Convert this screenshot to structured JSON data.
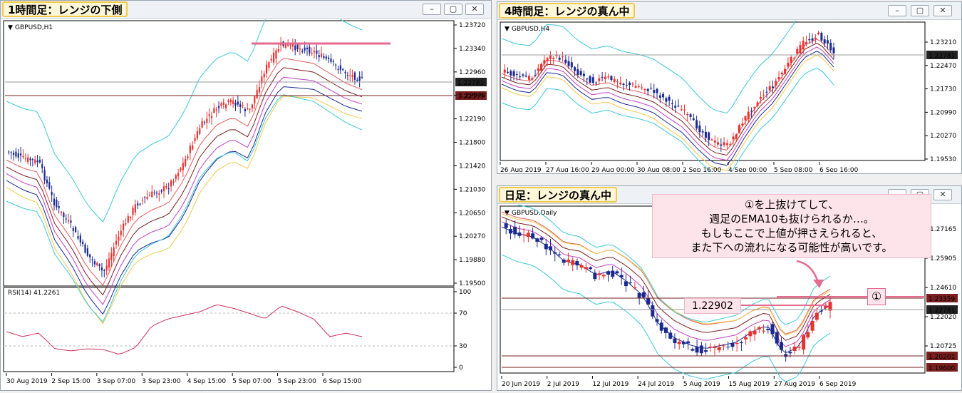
{
  "windows": [
    {
      "tag": "1時間足：レンジの下側",
      "symbol": "GBPUSD,H1",
      "rsi_label": "RSI(14) 41.2261",
      "price_ticks": [
        "1.23720",
        "1.23340",
        "1.22960",
        "1.22570",
        "1.22190",
        "1.21800",
        "1.21420",
        "1.21030",
        "1.20650",
        "1.20270",
        "1.19880",
        "1.19500"
      ],
      "price_tags": [
        "1.22781",
        "1.22559"
      ],
      "rsi_ticks": [
        "100",
        "70",
        "30",
        "0"
      ],
      "time_ticks": [
        "30 Aug 2019",
        "2 Sep 15:00",
        "3 Sep 07:00",
        "3 Sep 23:00",
        "4 Sep 15:00",
        "5 Sep 07:00",
        "5 Sep 23:00",
        "6 Sep 15:00"
      ]
    },
    {
      "tag": "4時間足：レンジの真ん中",
      "symbol": "GBPUSD,H4",
      "price_ticks": [
        "1.23210",
        "1.22470",
        "1.21730",
        "1.20990",
        "1.20270",
        "1.19530"
      ],
      "price_tags": [
        "1.22781"
      ],
      "time_ticks": [
        "26 Aug 2019",
        "27 Aug 16:00",
        "29 Aug 00:00",
        "30 Aug 08:00",
        "2 Sep 16:00",
        "4 Sep 00:00",
        "5 Sep 08:00",
        "6 Sep 16:00"
      ]
    },
    {
      "tag": "日足：レンジの真ん中",
      "symbol": "GBPUSD,Daily",
      "price_ticks": [
        "1.27165",
        "1.25905",
        "1.24610",
        "1.22020",
        "1.20725"
      ],
      "price_tags": [
        "1.23359",
        "1.22781",
        "1.20201",
        "1.19600"
      ],
      "time_ticks": [
        "20 Jun 2019",
        "2 Jul 2019",
        "12 Jul 2019",
        "24 Jul 2019",
        "5 Aug 2019",
        "15 Aug 2019",
        "27 Aug 2019",
        "6 Sep 2019"
      ],
      "annotation": "①を上抜けてして、\n週足のEMA10も抜けられるか…。\nもしもここで上値が押さえられると、\nまた下への流れになる可能性が高いです。",
      "level_label": "1.22902",
      "marker_label": "①"
    }
  ],
  "controls": {
    "minimize": "–",
    "restore": "▢",
    "close": "✕"
  },
  "colors": {
    "bull": "#e8322f",
    "bear": "#1c2a8f",
    "bb": "#3cc8d8",
    "ema_a": "#e45a5a",
    "ema_b": "#7a1f1f",
    "ema_c": "#c040c0",
    "ema_d": "#1c2a8f",
    "ema_e": "#f2c94c",
    "rsi": "#d0305a",
    "level": "#7a1f1f",
    "highlight": "#e46a8f"
  }
}
